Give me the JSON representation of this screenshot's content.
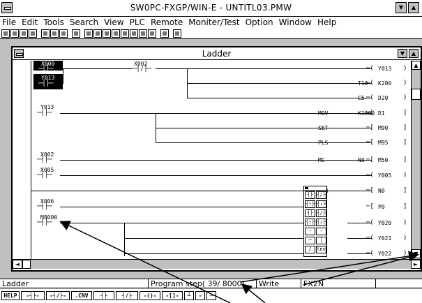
{
  "window": {
    "title": "SW0PC-FXGP/WIN-E - UNTITL03.PMW",
    "minimize_glyph": "▼",
    "maximize_glyph": "▲"
  },
  "menu": [
    "File",
    "Edit",
    "Tools",
    "Search",
    "View",
    "PLC",
    "Remote",
    "Moniter/Test",
    "Option",
    "Window",
    "Help"
  ],
  "ladder_window": {
    "title": "Ladder",
    "minimize_glyph": "▼",
    "maximize_glyph": "▲"
  },
  "ladder": {
    "contacts": {
      "x000": {
        "label": "X000",
        "symbol": "─┤├─"
      },
      "x002a": {
        "label": "X002",
        "symbol": "─┤/├─"
      },
      "y013": {
        "label": "Y013",
        "symbol": "─┤├─"
      },
      "y013b": {
        "label": "Y013",
        "symbol": "─┤├─"
      },
      "x002b": {
        "label": "X002",
        "symbol": "─┤├─"
      },
      "x005": {
        "label": "X005",
        "symbol": "─┤├─"
      },
      "x006": {
        "label": "X006",
        "symbol": "─┤├─"
      },
      "m8000": {
        "label": "M8000",
        "symbol": "─┤├─"
      }
    },
    "outputs": [
      {
        "instr": "",
        "op1": "",
        "op2": "Y013",
        "open": "─(",
        "close": ")"
      },
      {
        "instr": "",
        "op1": "T10",
        "op2": "K200",
        "open": "─(",
        "close": ")"
      },
      {
        "instr": "",
        "op1": "C5",
        "op2": "D20",
        "open": "─(",
        "close": ")"
      },
      {
        "instr": "MOV",
        "op1": "K1800",
        "op2": "D1",
        "open": "─[",
        "close": "]"
      },
      {
        "instr": "SET",
        "op1": "",
        "op2": "M90",
        "open": "─[",
        "close": "]"
      },
      {
        "instr": "PLS",
        "op1": "",
        "op2": "M95",
        "open": "─[",
        "close": "]"
      },
      {
        "instr": "MC",
        "op1": "N0",
        "op2": "M50",
        "open": "─[",
        "close": "]"
      },
      {
        "instr": "",
        "op1": "",
        "op2": "Y005",
        "open": "─(",
        "close": ")"
      },
      {
        "instr": "MCR",
        "op1": "",
        "op2": "N0",
        "open": "─[",
        "close": "]"
      },
      {
        "instr": "CJ",
        "op1": "",
        "op2": "P0",
        "open": "─[",
        "close": "]"
      },
      {
        "instr": "",
        "op1": "",
        "op2": "Y020",
        "open": "─(",
        "close": ")"
      },
      {
        "instr": "",
        "op1": "",
        "op2": "Y021",
        "open": "─(",
        "close": ")"
      },
      {
        "instr": "",
        "op1": "",
        "op2": "Y022",
        "open": "─(",
        "close": ")"
      }
    ]
  },
  "palette": {
    "buttons": [
      "┤├",
      "┤/├",
      "┤↑├",
      "┤↓├",
      "┤├",
      "┤/├",
      "┤↑├",
      "┤↓├",
      "-()-",
      "-[]-",
      "─",
      "│",
      "/",
      "lnv"
    ]
  },
  "scroll": {
    "up": "▲",
    "down": "▼",
    "left": "◄",
    "right": "►"
  },
  "status": {
    "mode": "Ladder",
    "step": "Program step( 39/ 8000)",
    "state": "Write",
    "plc": "FX2N"
  },
  "fkeys": [
    "HELP",
    "-┤├-",
    "-┤/├-",
    ".CNV",
    "┤├",
    "┤/├",
    "-()-",
    "-[]-",
    "┴",
    "-",
    "─"
  ]
}
